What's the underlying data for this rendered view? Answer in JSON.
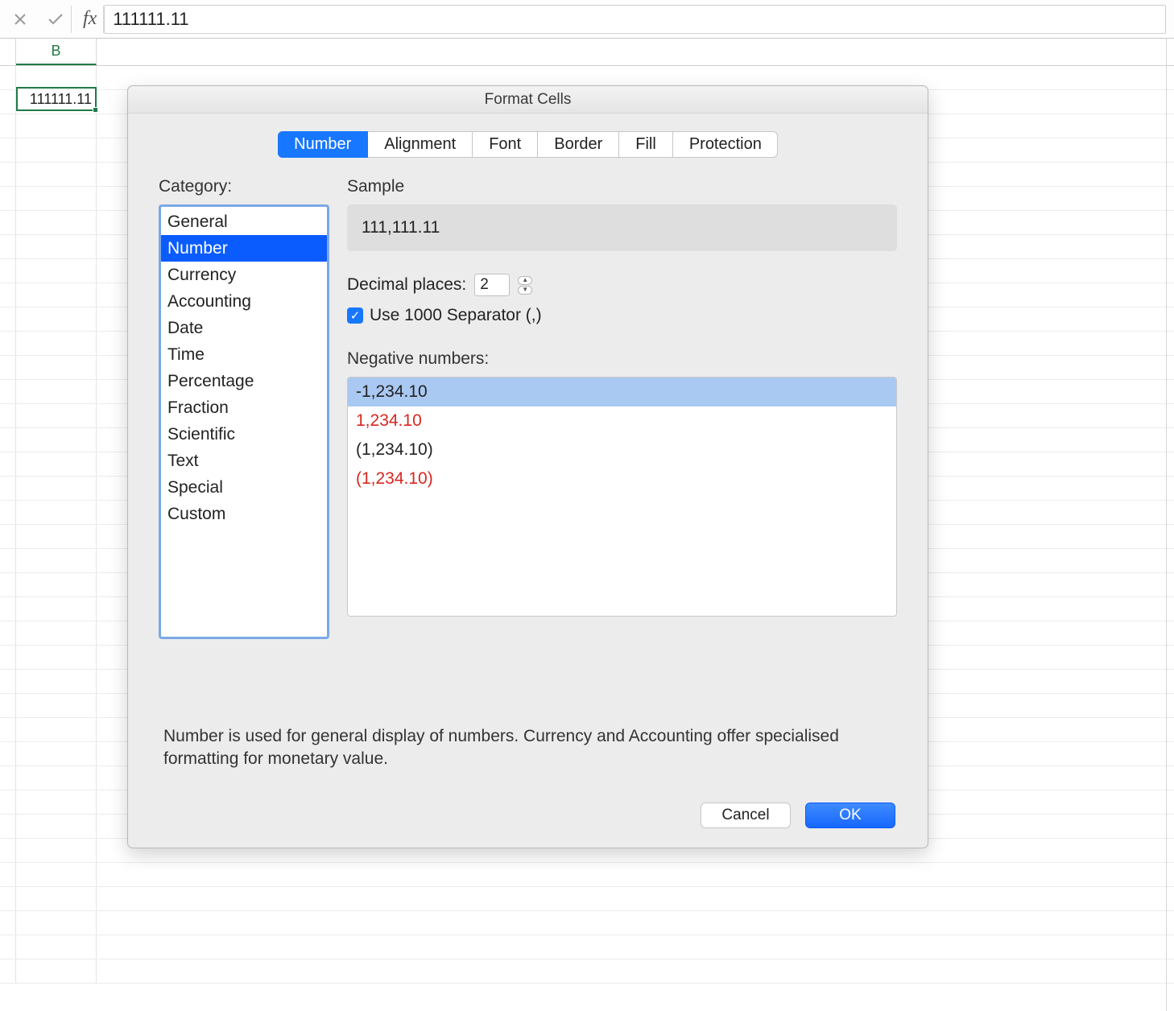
{
  "formula_bar": {
    "value": "111111.11",
    "fx_label": "fx"
  },
  "grid": {
    "column_header": "B",
    "active_cell_value": "111111.11"
  },
  "dialog": {
    "title": "Format Cells",
    "tabs": [
      {
        "label": "Number"
      },
      {
        "label": "Alignment"
      },
      {
        "label": "Font"
      },
      {
        "label": "Border"
      },
      {
        "label": "Fill"
      },
      {
        "label": "Protection"
      }
    ],
    "category_label": "Category:",
    "categories": [
      "General",
      "Number",
      "Currency",
      "Accounting",
      "Date",
      "Time",
      "Percentage",
      "Fraction",
      "Scientific",
      "Text",
      "Special",
      "Custom"
    ],
    "sample_label": "Sample",
    "sample_value": "111,111.11",
    "decimal_label": "Decimal places:",
    "decimal_value": "2",
    "separator_label": "Use 1000 Separator (,)",
    "negative_label": "Negative numbers:",
    "negative_formats": [
      {
        "text": "-1,234.10",
        "red": false
      },
      {
        "text": "1,234.10",
        "red": true
      },
      {
        "text": "(1,234.10)",
        "red": false
      },
      {
        "text": "(1,234.10)",
        "red": true
      }
    ],
    "description": "Number is used for general display of numbers.  Currency and Accounting offer specialised formatting for monetary value.",
    "cancel_label": "Cancel",
    "ok_label": "OK"
  }
}
